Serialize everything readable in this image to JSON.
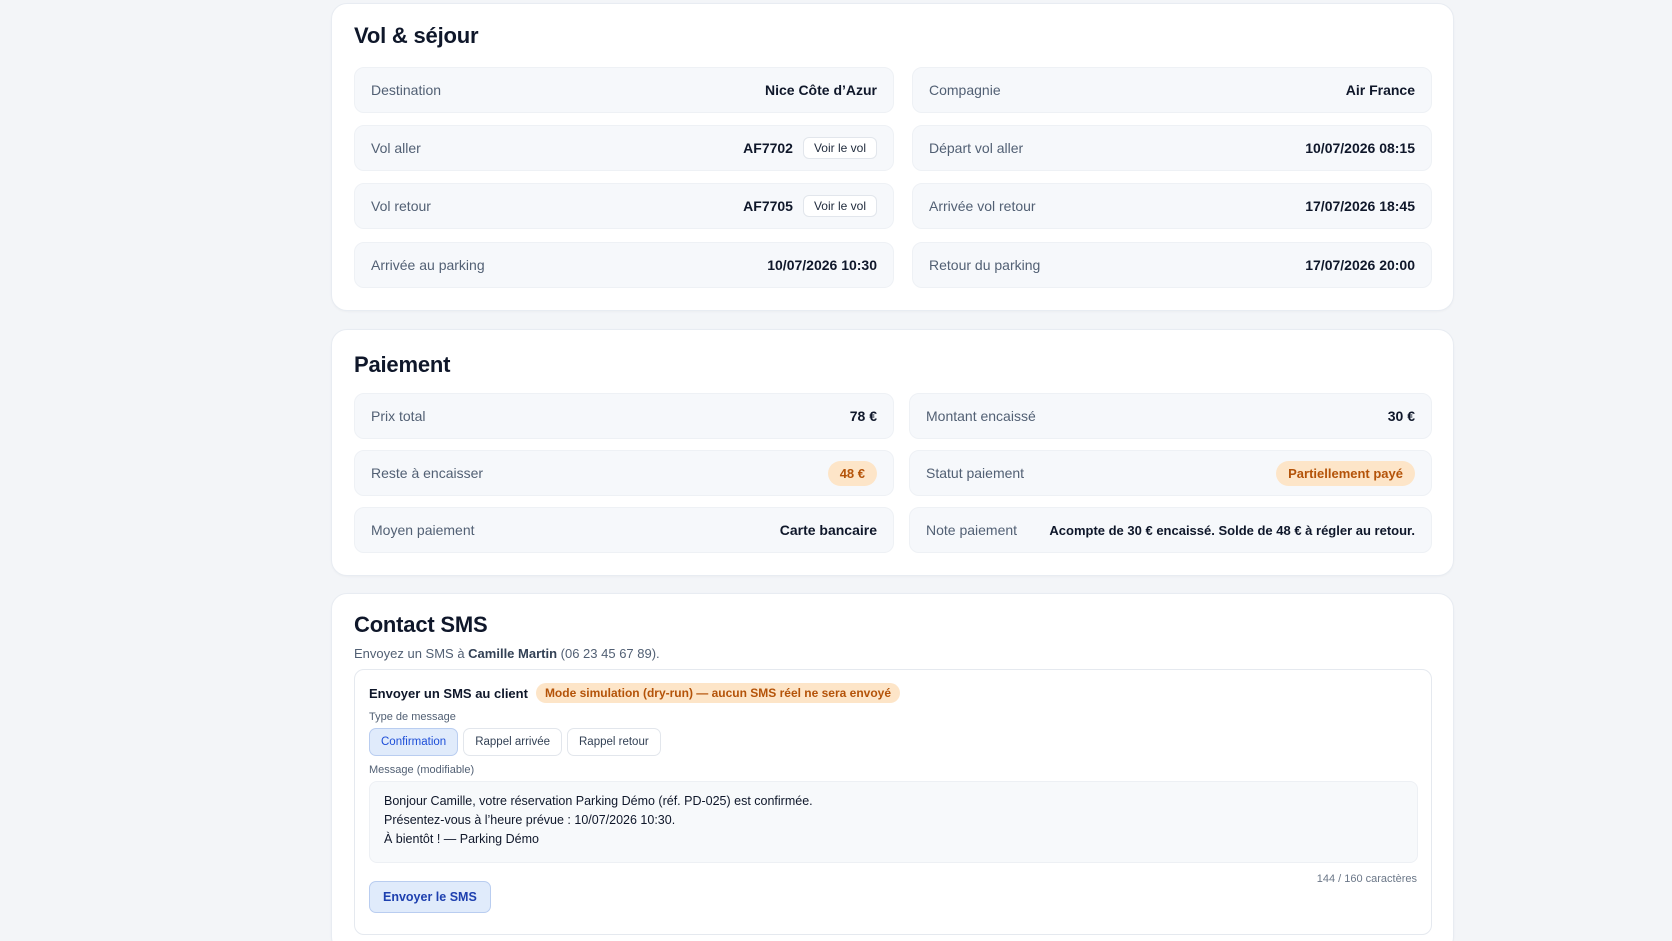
{
  "vol": {
    "title": "Vol & séjour",
    "destination_label": "Destination",
    "destination_value": "Nice Côte d’Azur",
    "compagnie_label": "Compagnie",
    "compagnie_value": "Air France",
    "vol_aller_label": "Vol aller",
    "vol_aller_value": "AF7702",
    "voir_vol_label": "Voir le vol",
    "depart_label": "Départ vol aller",
    "depart_value": "10/07/2026 08:15",
    "vol_retour_label": "Vol retour",
    "vol_retour_value": "AF7705",
    "arrivee_retour_label": "Arrivée vol retour",
    "arrivee_retour_value": "17/07/2026 18:45",
    "arrivee_parking_label": "Arrivée au parking",
    "arrivee_parking_value": "10/07/2026 10:30",
    "retour_parking_label": "Retour du parking",
    "retour_parking_value": "17/07/2026 20:00"
  },
  "paiement": {
    "title": "Paiement",
    "prix_total_label": "Prix total",
    "prix_total_value": "78 €",
    "montant_label": "Montant encaissé",
    "montant_value": "30 €",
    "reste_label": "Reste à encaisser",
    "reste_value": "48 €",
    "statut_label": "Statut paiement",
    "statut_value": "Partiellement payé",
    "moyen_label": "Moyen paiement",
    "moyen_value": "Carte bancaire",
    "note_label": "Note paiement",
    "note_value": "Acompte de 30 € encaissé. Solde de 48 € à régler au retour."
  },
  "sms": {
    "title": "Contact SMS",
    "intro_prefix": "Envoyez un SMS à ",
    "client_name": "Camille Martin",
    "client_phone": " (06 23 45 67 89).",
    "box_title": "Envoyer un SMS au client",
    "dry_run_badge": "Mode simulation (dry-run) — aucun SMS réel ne sera envoyé",
    "type_label": "Type de message",
    "types": [
      "Confirmation",
      "Rappel arrivée",
      "Rappel retour"
    ],
    "message_label": "Message (modifiable)",
    "message_text": "Bonjour Camille, votre réservation Parking Démo (réf. PD-025) est confirmée.\nPrésentez-vous à l’heure prévue : 10/07/2026 10:30.\nÀ bientôt ! — Parking Démo",
    "counter": "144 / 160 caractères",
    "send_label": "Envoyer le SMS"
  },
  "colors": {
    "accent": "#1d4ed8",
    "warning_bg": "#fde5c8",
    "warning_text": "#b45309"
  }
}
